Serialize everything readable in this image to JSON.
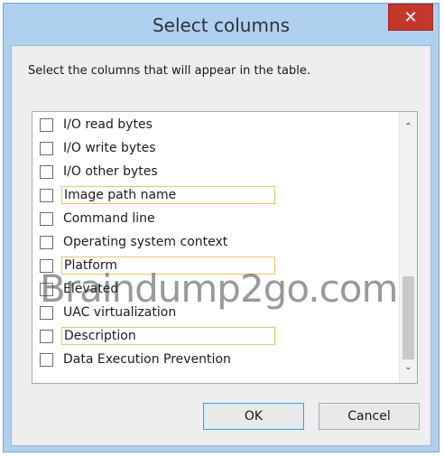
{
  "dialog": {
    "title": "Select columns",
    "close_glyph": "✕",
    "instruction": "Select the columns that will appear in the table."
  },
  "columns": [
    {
      "label": "I/O read bytes",
      "checked": false,
      "highlighted": false
    },
    {
      "label": "I/O write bytes",
      "checked": false,
      "highlighted": false
    },
    {
      "label": "I/O other bytes",
      "checked": false,
      "highlighted": false
    },
    {
      "label": "Image path name",
      "checked": false,
      "highlighted": true
    },
    {
      "label": "Command line",
      "checked": false,
      "highlighted": false
    },
    {
      "label": "Operating system context",
      "checked": false,
      "highlighted": false
    },
    {
      "label": "Platform",
      "checked": false,
      "highlighted": true
    },
    {
      "label": "Elevated",
      "checked": false,
      "highlighted": false
    },
    {
      "label": "UAC virtualization",
      "checked": false,
      "highlighted": false
    },
    {
      "label": "Description",
      "checked": false,
      "highlighted": true
    },
    {
      "label": "Data Execution Prevention",
      "checked": false,
      "highlighted": false
    }
  ],
  "scrollbar": {
    "up_glyph": "⌃",
    "down_glyph": "⌄",
    "position_fraction": 0.85
  },
  "watermark": "Braindump2go.com",
  "buttons": {
    "ok": "OK",
    "cancel": "Cancel"
  },
  "colors": {
    "title_bar": "#afd0ee",
    "close_button": "#c4372b",
    "highlight_border": "#e7c56b",
    "default_button_border": "#3c9fe0"
  }
}
